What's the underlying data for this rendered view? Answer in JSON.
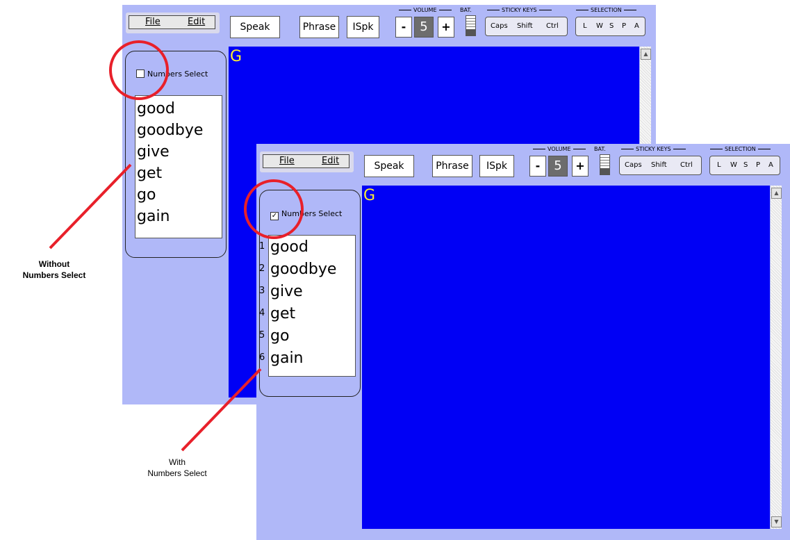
{
  "toolbar": {
    "file_label": "File",
    "edit_label": "Edit",
    "speak_label": "Speak",
    "phrase_label": "Phrase",
    "ispk_label": "ISpk",
    "volume_label": "VOLUME",
    "volume_minus": "-",
    "volume_value": "5",
    "volume_plus": "+",
    "battery_label": "BAT.",
    "sticky_keys_label": "STICKY KEYS",
    "sticky_keys": [
      "Caps",
      "Shift",
      "Ctrl"
    ],
    "selection_label": "SELECTION",
    "selection_keys": [
      "L",
      "W",
      "S",
      "P",
      "A"
    ]
  },
  "numbers_select_label": "Numbers Select",
  "window_without": {
    "numbers_select_checked": false,
    "words": [
      "good",
      "goodbye",
      "give",
      "get",
      "go",
      "gain"
    ],
    "text_content": "G"
  },
  "window_with": {
    "numbers_select_checked": true,
    "checkmark": "✓",
    "numbers": [
      "1",
      "2",
      "3",
      "4",
      "5",
      "6"
    ],
    "words": [
      "good",
      "goodbye",
      "give",
      "get",
      "go",
      "gain"
    ],
    "text_content": "G"
  },
  "scroll": {
    "up_arrow": "▲",
    "down_arrow": "▼"
  },
  "annotations": {
    "without_line1": "Without",
    "without_line2": "Numbers Select",
    "with_line1": "With",
    "with_line2": "Numbers Select"
  },
  "colors": {
    "window_bg": "#b0b8f8",
    "text_area": "#0000f5",
    "text_char": "#ffee33",
    "highlight": "#e8202a"
  }
}
